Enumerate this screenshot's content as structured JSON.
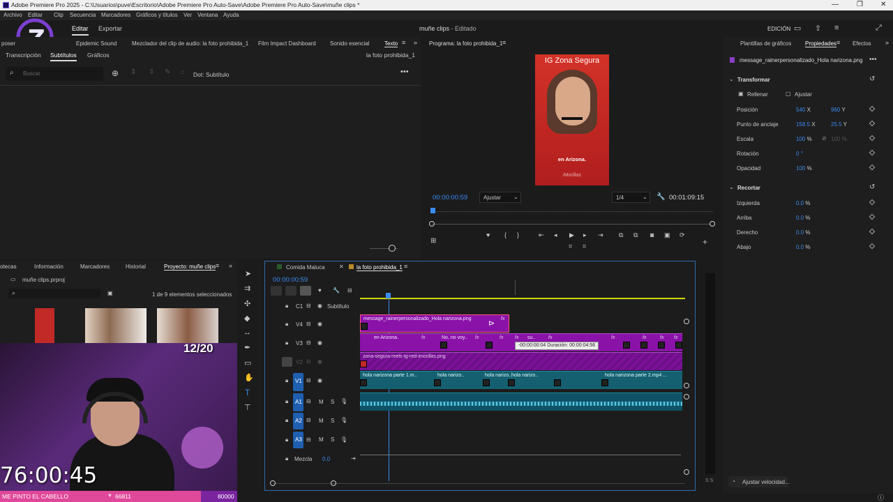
{
  "title_bar": {
    "text": "Adobe Premiere Pro 2025 - C:\\Usuarios\\puve\\Escritorio\\Adobe Premiere Pro Auto-Save\\Adobe Premiere Pro Auto-Save\\muñe clips *"
  },
  "menu": [
    "Archivo",
    "Editar",
    "Clip",
    "Secuencia",
    "Marcadores",
    "Gráficos y títulos",
    "Ver",
    "Ventana",
    "Ayuda"
  ],
  "header": {
    "editar": "Editar",
    "exportar": "Exportar",
    "doc_title": "muñe clips",
    "doc_status": "- Editado",
    "workspace": "EDICIÓN"
  },
  "top_left_tabs": [
    "poser",
    "Epidemic Sound",
    "Mezclador del clip de audio: la foto prohibida_1",
    "Film Impact Dashboard",
    "Sonido esencial",
    "Texto"
  ],
  "text_panel": {
    "tabs": [
      "Transcripción",
      "Subtítulos",
      "Gráficos"
    ],
    "sequence": "la foto prohibida_1",
    "search_placeholder": "Buscar",
    "dot_label": "Dot: Subtítulo"
  },
  "program": {
    "title": "Programa: la foto prohibida_1",
    "timecode": "00:00:00:59",
    "fit": "Ajustar",
    "ratio": "1/4",
    "duration": "00:01:09:15",
    "video_banner": "IG Zona Segura",
    "video_caption": "en Arizona.",
    "watermark": "iMorillas"
  },
  "right_tabs": [
    "Plantillas de gráficos",
    "Propiedades",
    "Efectos"
  ],
  "properties": {
    "file": "message_rainerpersonalizado_Hola narizona.png",
    "transform": "Transformar",
    "fill": "Rellenar",
    "fit": "Ajustar",
    "rows": [
      {
        "label": "Posición",
        "v1": "540",
        "u1": "X",
        "v2": "960",
        "u2": "Y"
      },
      {
        "label": "Punto de anclaje",
        "v1": "158.5",
        "u1": "X",
        "v2": "25.5",
        "u2": "Y"
      },
      {
        "label": "Escala",
        "v1": "100",
        "u1": "%",
        "v2": "100",
        "u2": "%"
      },
      {
        "label": "Rotación",
        "v1": "0",
        "u1": "°",
        "v2": "",
        "u2": ""
      },
      {
        "label": "Opacidad",
        "v1": "100",
        "u1": "%",
        "v2": "",
        "u2": ""
      }
    ],
    "crop": "Recortar",
    "crop_rows": [
      {
        "label": "Izquierda",
        "v": "0.0",
        "u": "%"
      },
      {
        "label": "Arriba",
        "v": "0.0",
        "u": "%"
      },
      {
        "label": "Derecho",
        "v": "0.0",
        "u": "%"
      },
      {
        "label": "Abajo",
        "v": "0.0",
        "u": "%"
      }
    ],
    "speed": "Ajustar velocidad..."
  },
  "project": {
    "tabs": [
      "otecas",
      "Información",
      "Marcadores",
      "Historial",
      "Proyecto: muñe clips"
    ],
    "file": "muñe clips.prproj",
    "count": "1 de 9 elementos seleccionados"
  },
  "timeline": {
    "tabs": [
      "Comida Maluca",
      "la foto prohibida_1"
    ],
    "timecode": "00:00:00:59",
    "tracks": {
      "c1": "C1",
      "subtitle": "Subtítulo",
      "v4": "V4",
      "v3": "V3",
      "v2": "V2",
      "v1": "V1",
      "a1": "A1",
      "a2": "A2",
      "a3": "A3",
      "m": "M",
      "s": "S",
      "mix": "Mezcla",
      "mix_val": "0.0"
    },
    "clips": {
      "v4": "message_rainerpersonalizado_Hola narizona.png",
      "v3a": "en Arizona.",
      "v3b": "No, no voy..",
      "v3c": "su..",
      "v2": "zona-segura-reels-tg-red-imorillas.png",
      "v1a": "hola narizona parte 1.m..",
      "v1b": "hola narizo..",
      "v1c": "hola narizo..",
      "v1d": "hola narizo..",
      "v1e": "hola narizona parte 2.mp4 ..."
    },
    "tooltip": "-00:00:00:04 Duración: 00:00:04:56"
  },
  "stream": {
    "counter": "12/20",
    "timer": "76:00:45",
    "ticker": "ME PINTO EL CABELLO",
    "points": "66811",
    "goal": "80000"
  },
  "meter_label": "S S",
  "colors": {
    "accent": "#3b8bf0",
    "clip_video": "#8a12a8",
    "clip_audio": "#156070",
    "stream_bar": "#e0489a"
  }
}
